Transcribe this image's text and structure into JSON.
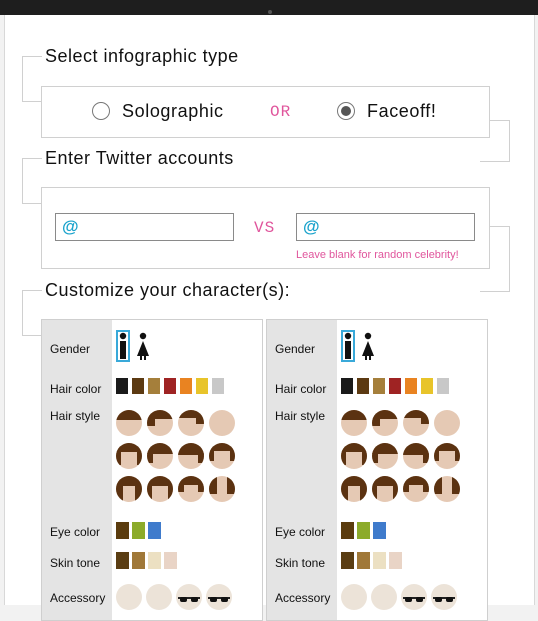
{
  "section_type": {
    "heading": "Select infographic type",
    "option_solo": "Solographic",
    "or_text": "OR",
    "option_faceoff": "Faceoff!",
    "selected": "Faceoff!"
  },
  "section_accounts": {
    "heading": "Enter Twitter accounts",
    "at_symbol": "@",
    "vs_text": "VS",
    "hint": "Leave blank for random celebrity!",
    "account1_value": "",
    "account2_value": ""
  },
  "section_customize": {
    "heading": "Customize your character(s):",
    "labels": {
      "gender": "Gender",
      "hair_color": "Hair color",
      "hair_style": "Hair style",
      "eye_color": "Eye color",
      "skin_tone": "Skin tone",
      "accessory": "Accessory"
    },
    "hair_colors": [
      "#1a1a1a",
      "#5c3a12",
      "#a57f3b",
      "#9f2323",
      "#e98321",
      "#e8c42a",
      "#c8c8c8"
    ],
    "eye_colors": [
      "#5b3c0e",
      "#8cab2a",
      "#3f7bcc"
    ],
    "skin_tones": [
      "#5a3d12",
      "#a07838",
      "#ece0c2",
      "#e9d4c6"
    ],
    "hair_color_sample": "#5b3211",
    "skin_sample": "#e5c9b4",
    "gender_selected": "male",
    "characters": [
      "character-1",
      "character-2"
    ]
  }
}
